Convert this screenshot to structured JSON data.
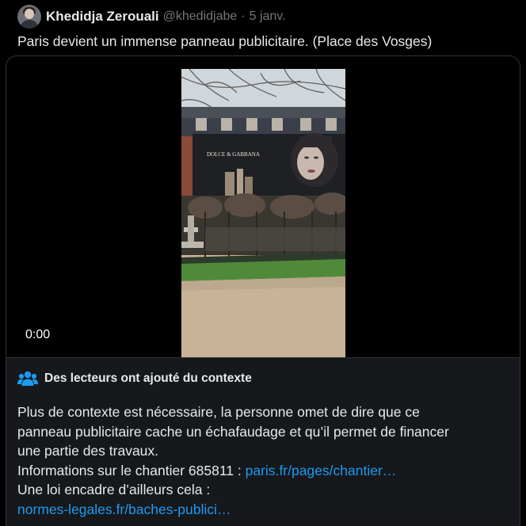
{
  "tweet": {
    "author_name": "Khedidja Zerouali",
    "handle": "@khedidjabe",
    "separator": "·",
    "date": "5 janv.",
    "text": "Paris devient un immense panneau publicitaire. (Place des Vosges)"
  },
  "video": {
    "time": "0:00",
    "billboard_brand": "DOLCE & GABBANA"
  },
  "community_note": {
    "title": "Des lecteurs ont ajouté du contexte",
    "line1": "Plus de contexte est nécessaire, la personne omet de dire que ce",
    "line2": "panneau publicitaire cache un échafaudage et qu’il permet de financer",
    "line3": "une partie des travaux.",
    "line4_text": "Informations sur le chantier 685811 : ",
    "line4_link": "paris.fr/pages/chantier…",
    "line5": "Une loi encadre d’ailleurs cela :",
    "line6_link": "normes-legales.fr/baches-publici…"
  },
  "colors": {
    "background": "#000000",
    "text": "#e7e9ea",
    "muted": "#71767b",
    "link": "#1d9bf0",
    "note_background": "#16181c"
  }
}
